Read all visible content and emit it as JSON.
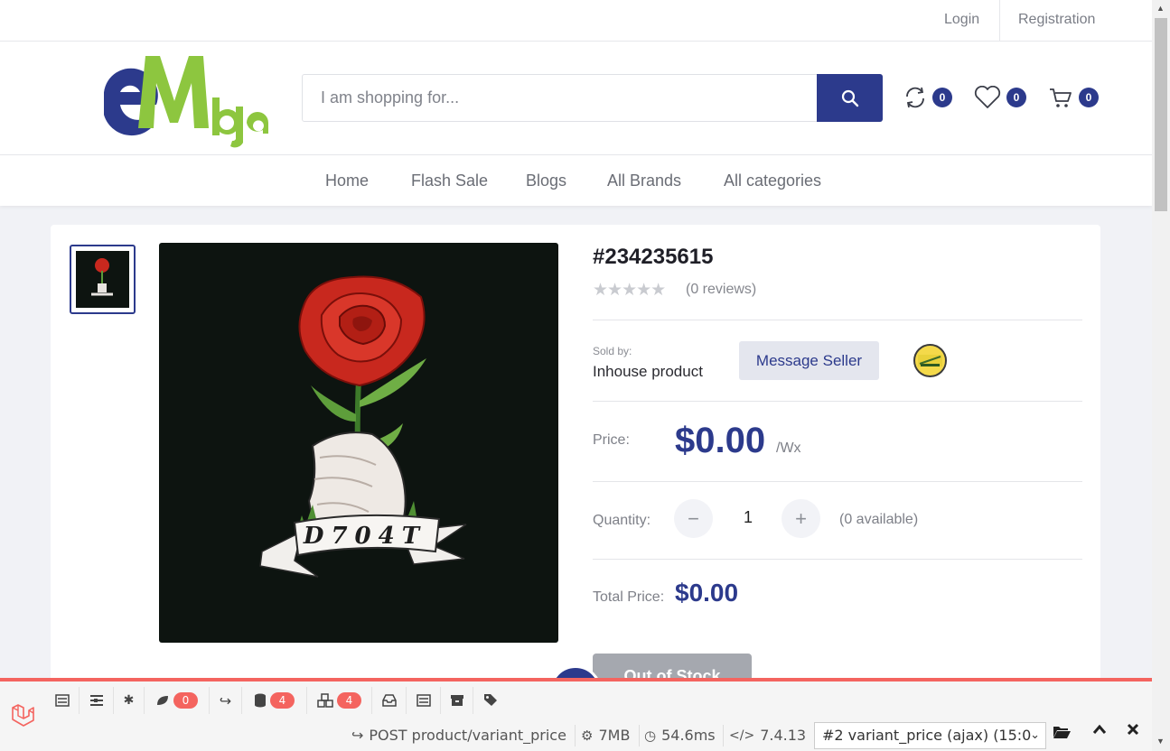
{
  "topbar": {
    "login": "Login",
    "registration": "Registration"
  },
  "header": {
    "logo_text": "eMbja",
    "search_placeholder": "I am shopping for...",
    "compare_count": "0",
    "wishlist_count": "0",
    "cart_count": "0"
  },
  "nav": {
    "items": [
      "Home",
      "Flash Sale",
      "Blogs",
      "All Brands",
      "All categories"
    ]
  },
  "product": {
    "title": "#234235615",
    "stars": "★★★★★",
    "reviews": "(0 reviews)",
    "sold_by_label": "Sold by:",
    "seller": "Inhouse product",
    "message_seller": "Message Seller",
    "price_label": "Price:",
    "price": "$0.00",
    "unit": "/Wx",
    "quantity_label": "Quantity:",
    "quantity": "1",
    "minus": "−",
    "plus": "+",
    "available": "(0 available)",
    "total_label": "Total Price:",
    "total": "$0.00",
    "out_of_stock": "Out of Stock",
    "image_text": "D704T"
  },
  "debugbar": {
    "badges": {
      "messages": "0",
      "queries": "4",
      "models": "4"
    },
    "request": "POST product/variant_price",
    "memory": "7MB",
    "time": "54.6ms",
    "php": "7.4.13",
    "select_value": "#2 variant_price (ajax) (15:0"
  },
  "colors": {
    "brand": "#2c3a8c",
    "logo_green": "#8dc63f",
    "debug_accent": "#f4645f"
  }
}
